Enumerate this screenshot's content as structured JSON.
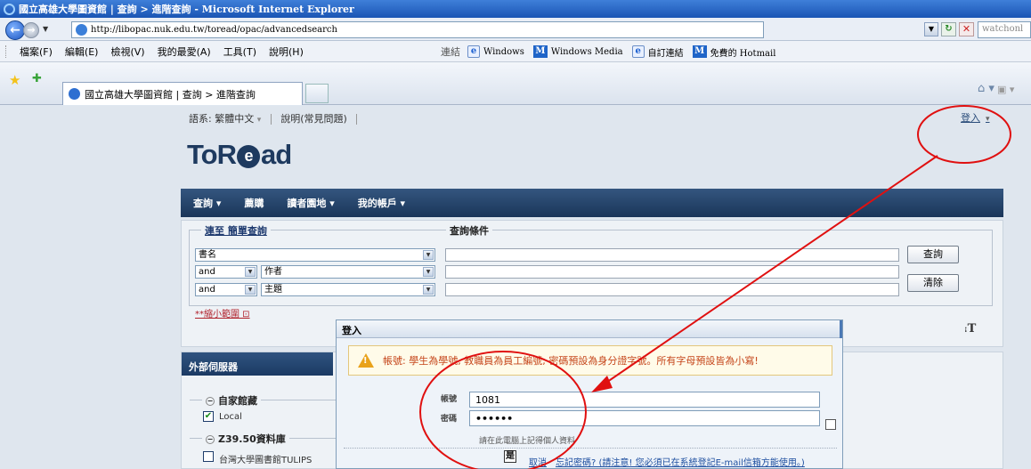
{
  "window": {
    "title": "國立高雄大學圖資館 | 查詢 > 進階查詢 - Microsoft Internet Explorer"
  },
  "address_bar": {
    "url": "http://libopac.nuk.edu.tw/toread/opac/advancedsearch",
    "search_placeholder": "watchonl"
  },
  "menu": {
    "items": [
      "檔案(F)",
      "編輯(E)",
      "檢視(V)",
      "我的最愛(A)",
      "工具(T)",
      "說明(H)"
    ],
    "links_label": "連結",
    "links": [
      "Windows",
      "Windows Media",
      "自訂連結",
      "免費的 Hotmail"
    ]
  },
  "tab": {
    "title": "國立高雄大學圖資館 | 查詢 > 進階查詢"
  },
  "site": {
    "language": "語系: 繁體中文",
    "help": "說明(常見問題)",
    "login": "登入",
    "logo_pre": "ToR",
    "logo_at": "e",
    "logo_post": "ad",
    "nav": [
      "查詢 ▾",
      "薦購",
      "讀者園地 ▾",
      "我的帳戶 ▾"
    ]
  },
  "search": {
    "switch_link": "連至 簡單查詢",
    "conditions_title": "查詢條件",
    "rows": [
      {
        "op": "",
        "field": "書名"
      },
      {
        "op": "and",
        "field": "作者"
      },
      {
        "op": "and",
        "field": "主題"
      }
    ],
    "search_button": "查詢",
    "clear_button": "清除",
    "narrow_link": "**縮小範圍"
  },
  "external": {
    "header": "外部伺服器",
    "groups": [
      {
        "label": "自家館藏",
        "item": "Local",
        "checked": true
      },
      {
        "label": "Z39.50資料庫",
        "item": "台灣大學圖書館TULIPS",
        "checked": false
      }
    ]
  },
  "login_dialog": {
    "title": "登入",
    "warning": "帳號: 學生為學號, 教職員為員工編號; 密碼預設為身分證字號。所有字母預設皆為小寫!",
    "account_label": "帳號",
    "account_value": "1081",
    "password_label": "密碼",
    "password_value": "••••••",
    "remember_text": "請在此電腦上記得個人資料",
    "ok_button": "是",
    "cancel_link": "取消",
    "forgot_link": "忘記密碼? (請注意! 您必須已在系統登記E-mail信箱方能使用。)"
  },
  "colors": {
    "nav_bg": "#1a3559",
    "annotation_red": "#e01010",
    "warning_text": "#c5451a"
  }
}
